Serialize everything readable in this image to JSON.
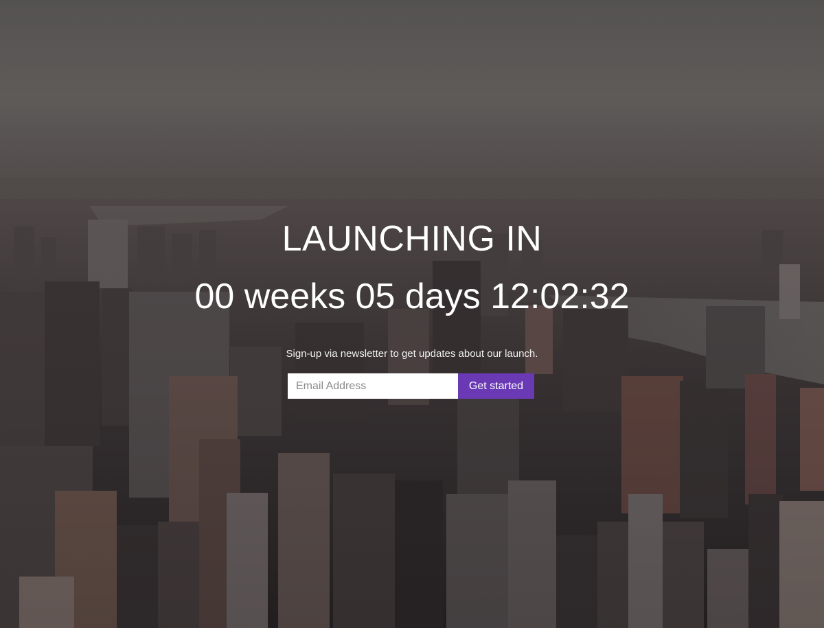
{
  "hero": {
    "headline": "LAUNCHING IN",
    "countdown": "00 weeks 05 days 12:02:32",
    "tagline": "Sign-up via newsletter to get updates about our launch."
  },
  "signup": {
    "email_placeholder": "Email Address",
    "button_label": "Get started"
  },
  "colors": {
    "accent": "#6a3ab5",
    "text": "#ffffff",
    "sky": "#6b6866"
  }
}
